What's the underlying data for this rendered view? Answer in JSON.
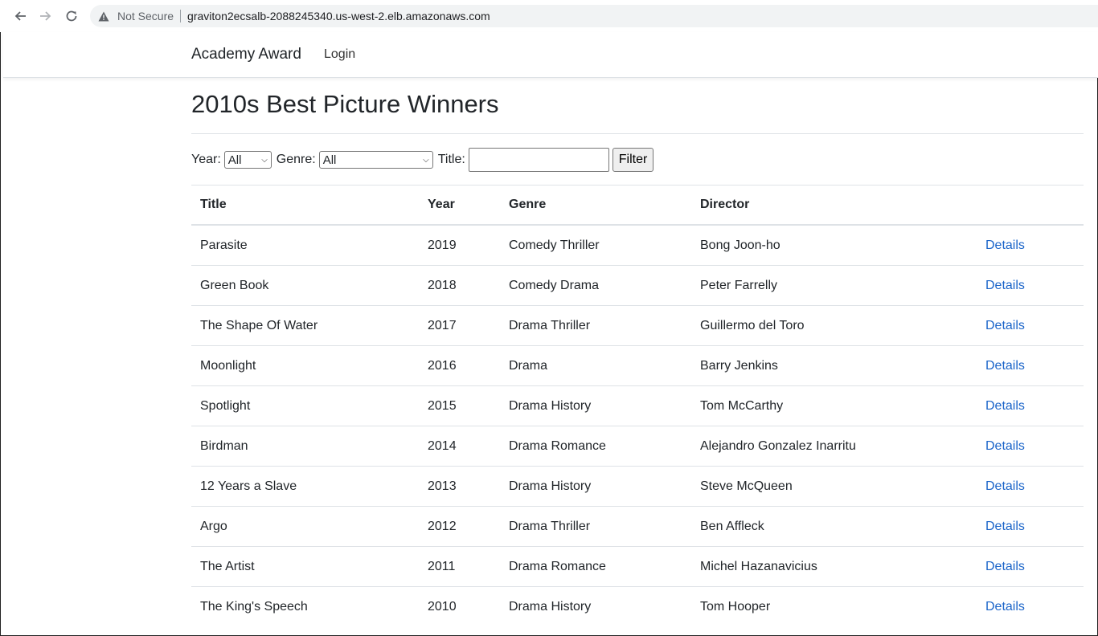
{
  "browser": {
    "security_label": "Not Secure",
    "url": "graviton2ecsalb-2088245340.us-west-2.elb.amazonaws.com"
  },
  "navbar": {
    "brand": "Academy Award",
    "login": "Login"
  },
  "page": {
    "title": "2010s Best Picture Winners"
  },
  "filters": {
    "year_label": "Year:",
    "year_value": "All",
    "genre_label": "Genre:",
    "genre_value": "All",
    "title_label": "Title:",
    "title_value": "",
    "filter_button": "Filter"
  },
  "table": {
    "headers": [
      "Title",
      "Year",
      "Genre",
      "Director",
      ""
    ],
    "link_label": "Details",
    "rows": [
      {
        "title": "Parasite",
        "year": "2019",
        "genre": "Comedy Thriller",
        "director": "Bong Joon-ho"
      },
      {
        "title": "Green Book",
        "year": "2018",
        "genre": "Comedy Drama",
        "director": "Peter Farrelly"
      },
      {
        "title": "The Shape Of Water",
        "year": "2017",
        "genre": "Drama Thriller",
        "director": "Guillermo del Toro"
      },
      {
        "title": "Moonlight",
        "year": "2016",
        "genre": "Drama",
        "director": "Barry Jenkins"
      },
      {
        "title": "Spotlight",
        "year": "2015",
        "genre": "Drama History",
        "director": "Tom McCarthy"
      },
      {
        "title": "Birdman",
        "year": "2014",
        "genre": "Drama Romance",
        "director": "Alejandro Gonzalez Inarritu"
      },
      {
        "title": "12 Years a Slave",
        "year": "2013",
        "genre": "Drama History",
        "director": "Steve McQueen"
      },
      {
        "title": "Argo",
        "year": "2012",
        "genre": "Drama Thriller",
        "director": "Ben Affleck"
      },
      {
        "title": "The Artist",
        "year": "2011",
        "genre": "Drama Romance",
        "director": "Michel Hazanavicius"
      },
      {
        "title": "The King's Speech",
        "year": "2010",
        "genre": "Drama History",
        "director": "Tom Hooper"
      }
    ]
  },
  "colors": {
    "link": "#1a64c9",
    "border": "#dee2e6",
    "omnibox": "#f1f3f4"
  },
  "icons": [
    "back-arrow-icon",
    "forward-arrow-icon",
    "reload-icon",
    "warning-icon",
    "chevron-down-icon"
  ]
}
